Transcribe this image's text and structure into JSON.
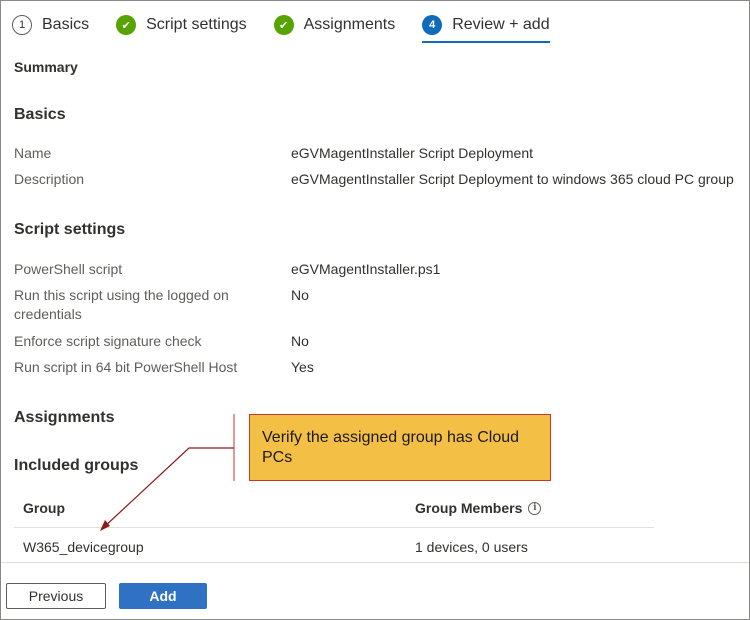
{
  "steps": [
    {
      "number": "1",
      "label": "Basics",
      "state": "pending"
    },
    {
      "number": "",
      "label": "Script settings",
      "state": "complete"
    },
    {
      "number": "",
      "label": "Assignments",
      "state": "complete"
    },
    {
      "number": "4",
      "label": "Review + add",
      "state": "current"
    }
  ],
  "summary": "Summary",
  "basics": {
    "title": "Basics",
    "rows": [
      {
        "key": "Name",
        "value": "eGVMagentInstaller Script Deployment"
      },
      {
        "key": "Description",
        "value": "eGVMagentInstaller Script Deployment to windows 365 cloud PC group"
      }
    ]
  },
  "script_settings": {
    "title": "Script settings",
    "rows": [
      {
        "key": "PowerShell script",
        "value": "eGVMagentInstaller.ps1"
      },
      {
        "key": "Run this script using the logged on credentials",
        "value": "No"
      },
      {
        "key": "Enforce script signature check",
        "value": "No"
      },
      {
        "key": "Run script in 64 bit PowerShell Host",
        "value": "Yes"
      }
    ]
  },
  "assignments": {
    "title": "Assignments",
    "included_title": "Included groups",
    "columns": [
      "Group",
      "Group Members"
    ],
    "rows": [
      {
        "group": "W365_devicegroup",
        "members": "1 devices, 0 users"
      }
    ]
  },
  "callout": {
    "text": "Verify the assigned group has Cloud PCs",
    "fill": "#f4bf45",
    "border": "#c0392b"
  },
  "footer": {
    "previous_label": "Previous",
    "add_label": "Add"
  },
  "colors": {
    "accent": "#0f6cbd",
    "complete": "#57a300",
    "primary_button": "#2f72c4"
  }
}
